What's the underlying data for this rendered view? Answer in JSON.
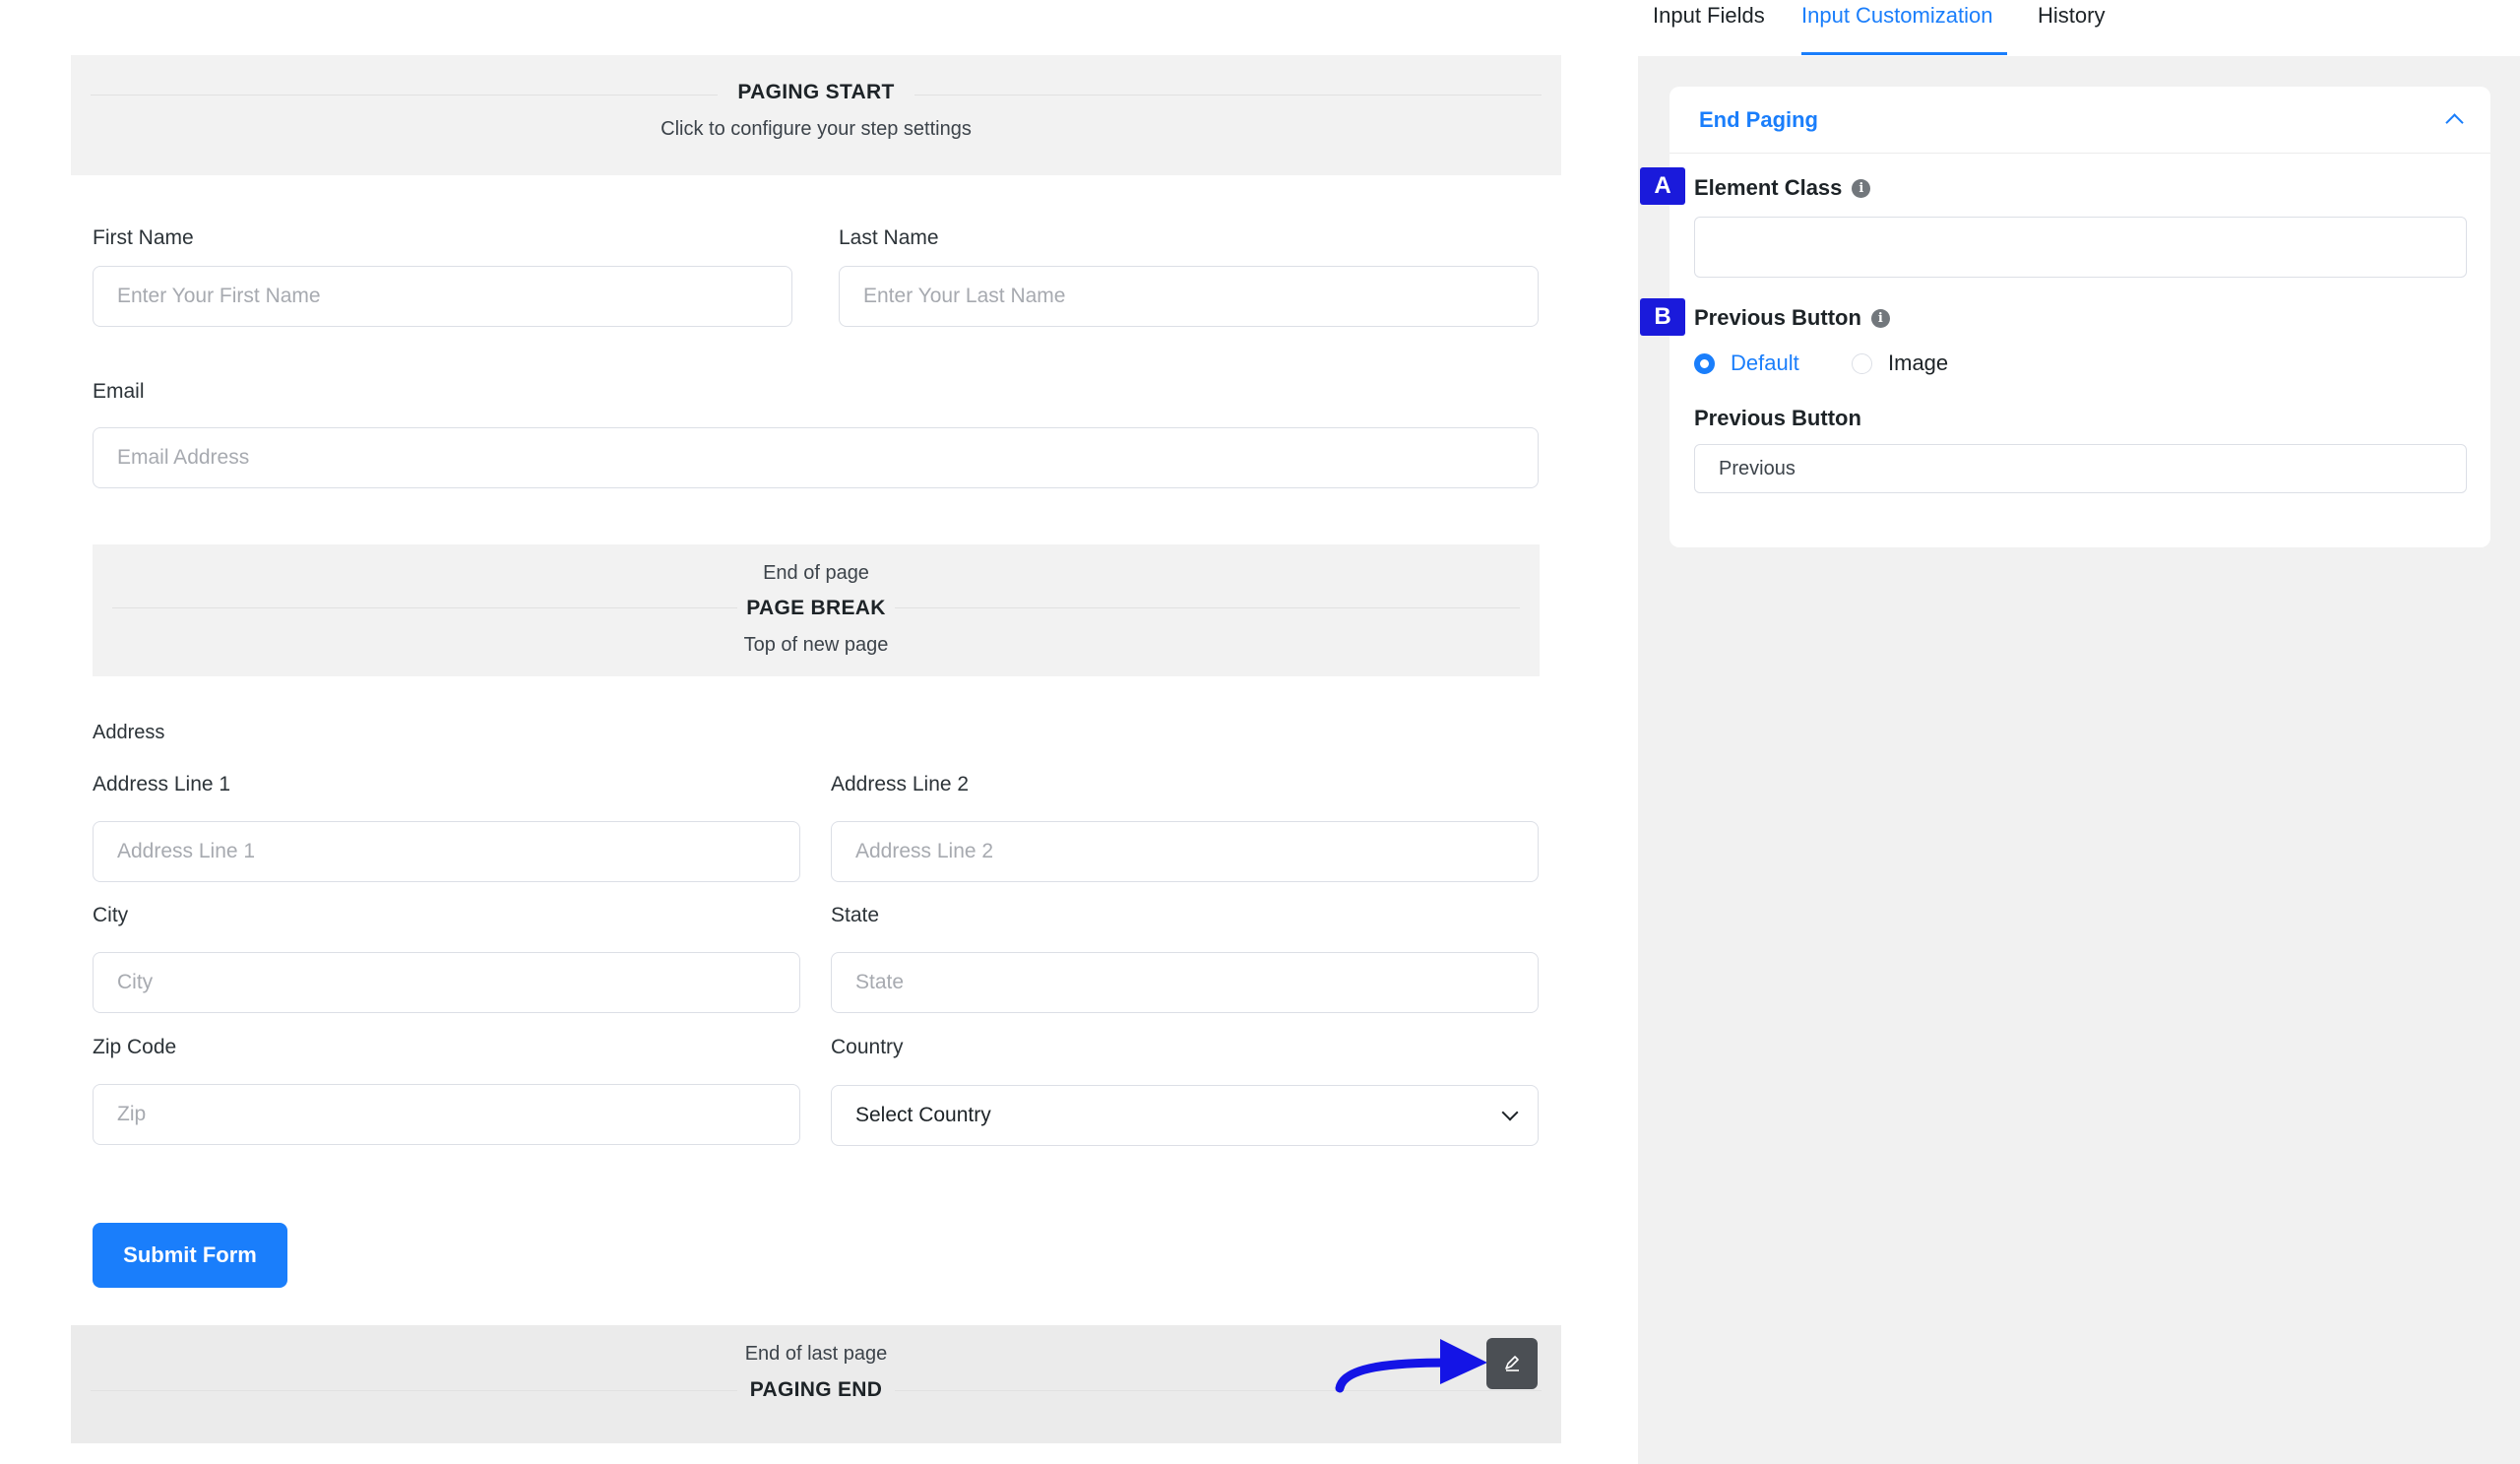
{
  "paging_start": {
    "title": "PAGING START",
    "subtitle": "Click to configure your step settings"
  },
  "form": {
    "first_name": {
      "label": "First Name",
      "placeholder": "Enter Your First Name"
    },
    "last_name": {
      "label": "Last Name",
      "placeholder": "Enter Your Last Name"
    },
    "email": {
      "label": "Email",
      "placeholder": "Email Address"
    },
    "page_break": {
      "top_text": "End of page",
      "title": "PAGE BREAK",
      "bottom_text": "Top of new page"
    },
    "address": {
      "section_label": "Address",
      "line1": {
        "label": "Address Line 1",
        "placeholder": "Address Line 1"
      },
      "line2": {
        "label": "Address Line 2",
        "placeholder": "Address Line 2"
      },
      "city": {
        "label": "City",
        "placeholder": "City"
      },
      "state": {
        "label": "State",
        "placeholder": "State"
      },
      "zip": {
        "label": "Zip Code",
        "placeholder": "Zip"
      },
      "country": {
        "label": "Country",
        "value": "Select Country"
      }
    },
    "submit_label": "Submit Form"
  },
  "paging_end": {
    "top_text": "End of last page",
    "title": "PAGING END"
  },
  "tabs": [
    {
      "label": "Input Fields",
      "active": false
    },
    {
      "label": "Input Customization",
      "active": true
    },
    {
      "label": "History",
      "active": false
    }
  ],
  "settings": {
    "section_title": "End Paging",
    "element_class": {
      "badge": "A",
      "label": "Element Class",
      "value": ""
    },
    "previous_button_type": {
      "badge": "B",
      "label": "Previous Button",
      "options": [
        {
          "label": "Default",
          "checked": true
        },
        {
          "label": "Image",
          "checked": false
        }
      ]
    },
    "previous_button_text": {
      "label": "Previous Button",
      "value": "Previous"
    }
  },
  "colors": {
    "accent": "#1a7efb",
    "badge": "#1a1adb",
    "arrow": "#1414e6"
  },
  "icons": {
    "edit": "pen-icon",
    "info": "info-icon",
    "collapse": "chevron-up-icon",
    "dropdown": "chevron-down-icon"
  }
}
